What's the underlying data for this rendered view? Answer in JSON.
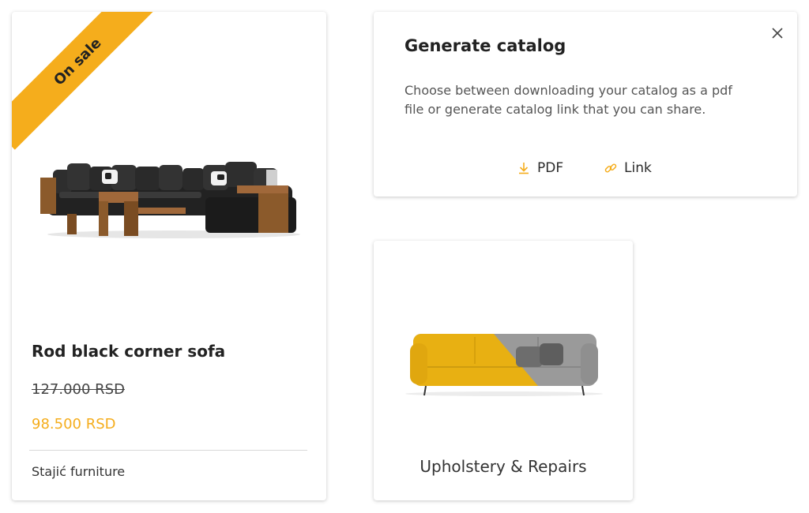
{
  "product": {
    "badge": "On sale",
    "title": "Rod black corner sofa",
    "old_price": "127.000 RSD",
    "new_price": "98.500 RSD",
    "vendor": "Stajić furniture",
    "image": "black-corner-sofa-image"
  },
  "catalog_dialog": {
    "title": "Generate catalog",
    "description": "Choose between downloading your catalog as a pdf file or generate catalog link that you can share.",
    "close_icon": "close-icon",
    "actions": [
      {
        "label": "PDF",
        "icon": "download-icon"
      },
      {
        "label": "Link",
        "icon": "link-icon"
      }
    ]
  },
  "category": {
    "label": "Upholstery & Repairs",
    "image": "yellow-grey-sofa-image"
  },
  "colors": {
    "accent": "#f5ad1c",
    "text": "#2a2a2a",
    "muted": "#555555",
    "divider": "#d8d8d8"
  }
}
